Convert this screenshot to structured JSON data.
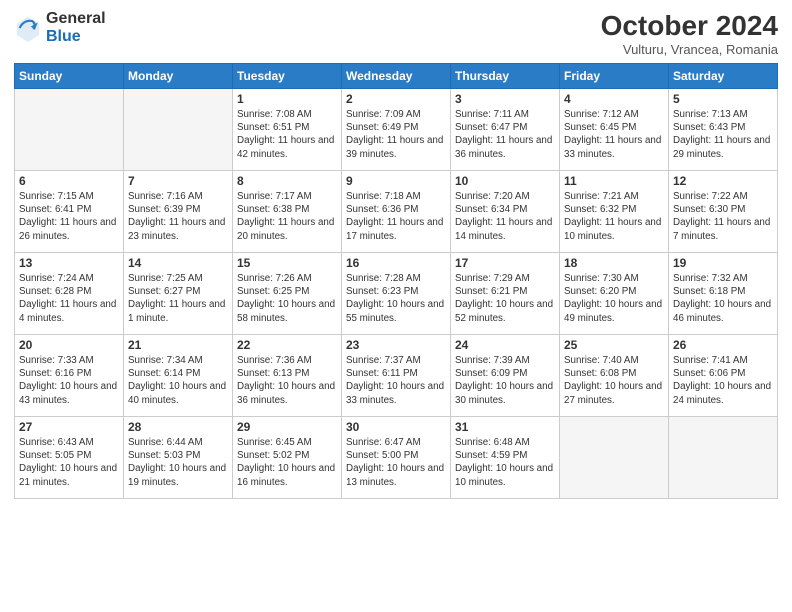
{
  "header": {
    "logo_general": "General",
    "logo_blue": "Blue",
    "month_title": "October 2024",
    "subtitle": "Vulturu, Vrancea, Romania"
  },
  "weekdays": [
    "Sunday",
    "Monday",
    "Tuesday",
    "Wednesday",
    "Thursday",
    "Friday",
    "Saturday"
  ],
  "weeks": [
    [
      {
        "day": "",
        "empty": true
      },
      {
        "day": "",
        "empty": true
      },
      {
        "day": "1",
        "sunrise": "7:08 AM",
        "sunset": "6:51 PM",
        "daylight": "11 hours and 42 minutes."
      },
      {
        "day": "2",
        "sunrise": "7:09 AM",
        "sunset": "6:49 PM",
        "daylight": "11 hours and 39 minutes."
      },
      {
        "day": "3",
        "sunrise": "7:11 AM",
        "sunset": "6:47 PM",
        "daylight": "11 hours and 36 minutes."
      },
      {
        "day": "4",
        "sunrise": "7:12 AM",
        "sunset": "6:45 PM",
        "daylight": "11 hours and 33 minutes."
      },
      {
        "day": "5",
        "sunrise": "7:13 AM",
        "sunset": "6:43 PM",
        "daylight": "11 hours and 29 minutes."
      }
    ],
    [
      {
        "day": "6",
        "sunrise": "7:15 AM",
        "sunset": "6:41 PM",
        "daylight": "11 hours and 26 minutes."
      },
      {
        "day": "7",
        "sunrise": "7:16 AM",
        "sunset": "6:39 PM",
        "daylight": "11 hours and 23 minutes."
      },
      {
        "day": "8",
        "sunrise": "7:17 AM",
        "sunset": "6:38 PM",
        "daylight": "11 hours and 20 minutes."
      },
      {
        "day": "9",
        "sunrise": "7:18 AM",
        "sunset": "6:36 PM",
        "daylight": "11 hours and 17 minutes."
      },
      {
        "day": "10",
        "sunrise": "7:20 AM",
        "sunset": "6:34 PM",
        "daylight": "11 hours and 14 minutes."
      },
      {
        "day": "11",
        "sunrise": "7:21 AM",
        "sunset": "6:32 PM",
        "daylight": "11 hours and 10 minutes."
      },
      {
        "day": "12",
        "sunrise": "7:22 AM",
        "sunset": "6:30 PM",
        "daylight": "11 hours and 7 minutes."
      }
    ],
    [
      {
        "day": "13",
        "sunrise": "7:24 AM",
        "sunset": "6:28 PM",
        "daylight": "11 hours and 4 minutes."
      },
      {
        "day": "14",
        "sunrise": "7:25 AM",
        "sunset": "6:27 PM",
        "daylight": "11 hours and 1 minute."
      },
      {
        "day": "15",
        "sunrise": "7:26 AM",
        "sunset": "6:25 PM",
        "daylight": "10 hours and 58 minutes."
      },
      {
        "day": "16",
        "sunrise": "7:28 AM",
        "sunset": "6:23 PM",
        "daylight": "10 hours and 55 minutes."
      },
      {
        "day": "17",
        "sunrise": "7:29 AM",
        "sunset": "6:21 PM",
        "daylight": "10 hours and 52 minutes."
      },
      {
        "day": "18",
        "sunrise": "7:30 AM",
        "sunset": "6:20 PM",
        "daylight": "10 hours and 49 minutes."
      },
      {
        "day": "19",
        "sunrise": "7:32 AM",
        "sunset": "6:18 PM",
        "daylight": "10 hours and 46 minutes."
      }
    ],
    [
      {
        "day": "20",
        "sunrise": "7:33 AM",
        "sunset": "6:16 PM",
        "daylight": "10 hours and 43 minutes."
      },
      {
        "day": "21",
        "sunrise": "7:34 AM",
        "sunset": "6:14 PM",
        "daylight": "10 hours and 40 minutes."
      },
      {
        "day": "22",
        "sunrise": "7:36 AM",
        "sunset": "6:13 PM",
        "daylight": "10 hours and 36 minutes."
      },
      {
        "day": "23",
        "sunrise": "7:37 AM",
        "sunset": "6:11 PM",
        "daylight": "10 hours and 33 minutes."
      },
      {
        "day": "24",
        "sunrise": "7:39 AM",
        "sunset": "6:09 PM",
        "daylight": "10 hours and 30 minutes."
      },
      {
        "day": "25",
        "sunrise": "7:40 AM",
        "sunset": "6:08 PM",
        "daylight": "10 hours and 27 minutes."
      },
      {
        "day": "26",
        "sunrise": "7:41 AM",
        "sunset": "6:06 PM",
        "daylight": "10 hours and 24 minutes."
      }
    ],
    [
      {
        "day": "27",
        "sunrise": "6:43 AM",
        "sunset": "5:05 PM",
        "daylight": "10 hours and 21 minutes."
      },
      {
        "day": "28",
        "sunrise": "6:44 AM",
        "sunset": "5:03 PM",
        "daylight": "10 hours and 19 minutes."
      },
      {
        "day": "29",
        "sunrise": "6:45 AM",
        "sunset": "5:02 PM",
        "daylight": "10 hours and 16 minutes."
      },
      {
        "day": "30",
        "sunrise": "6:47 AM",
        "sunset": "5:00 PM",
        "daylight": "10 hours and 13 minutes."
      },
      {
        "day": "31",
        "sunrise": "6:48 AM",
        "sunset": "4:59 PM",
        "daylight": "10 hours and 10 minutes."
      },
      {
        "day": "",
        "empty": true
      },
      {
        "day": "",
        "empty": true
      }
    ]
  ]
}
